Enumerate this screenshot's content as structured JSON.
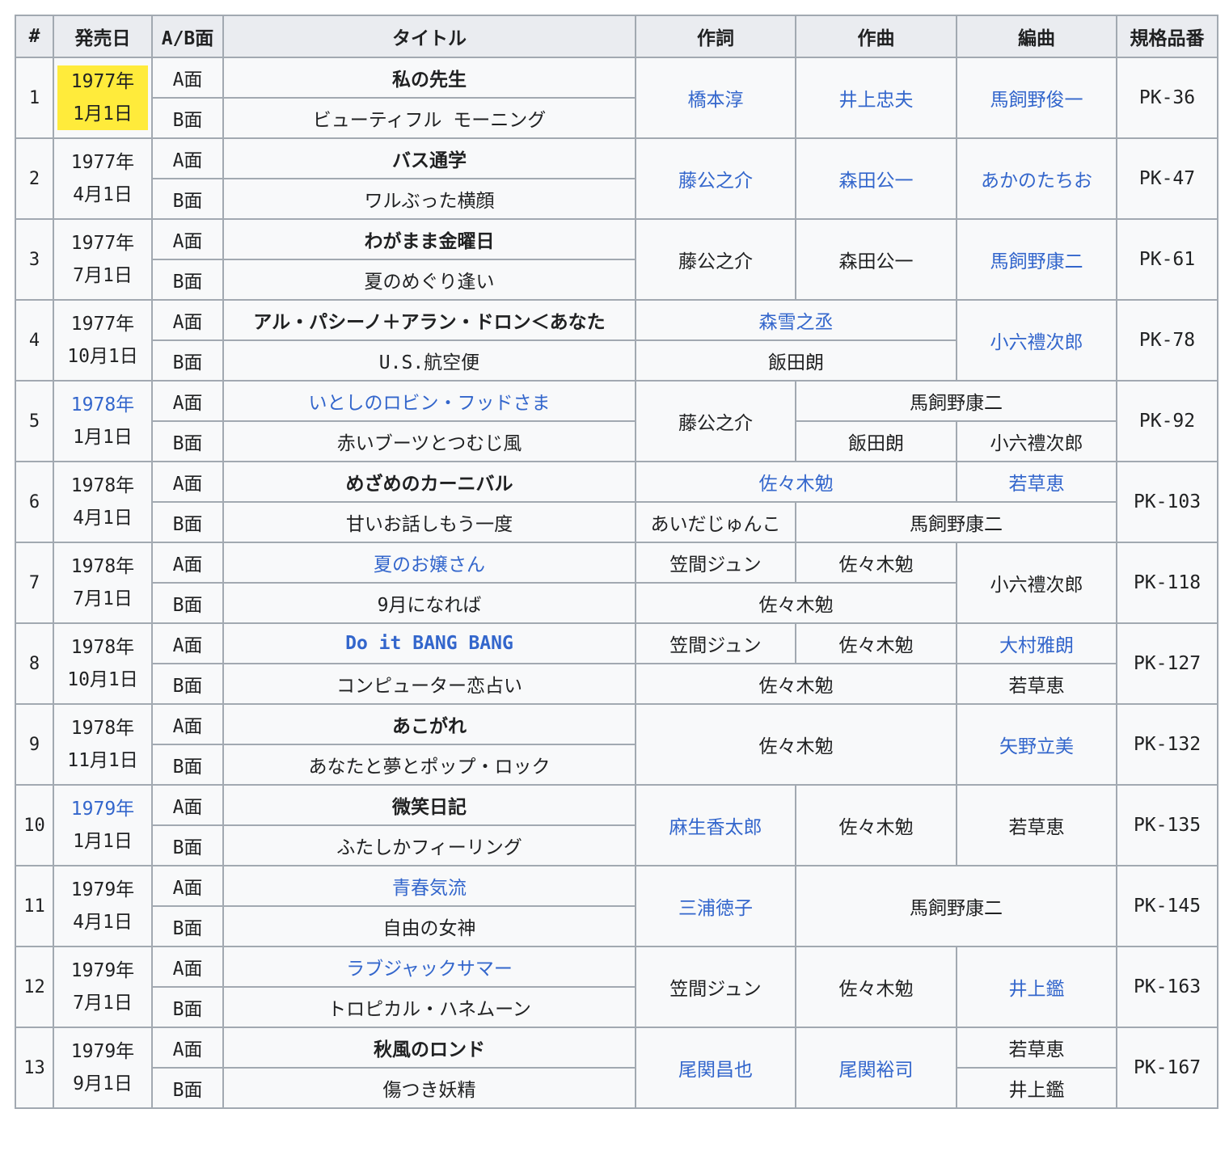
{
  "headers": [
    "#",
    "発売日",
    "A/B面",
    "タイトル",
    "作詞",
    "作曲",
    "編曲",
    "規格品番"
  ],
  "a_side": "A面",
  "b_side": "B面",
  "rows": [
    {
      "num": "1",
      "year": "1977年",
      "day": "1月1日",
      "a": "私の先生",
      "b": "ビューティフル モーニング",
      "lyric": "橋本淳",
      "composer": "井上忠夫",
      "arranger": "馬飼野俊一",
      "catalog": "PK-36"
    },
    {
      "num": "2",
      "year": "1977年",
      "day": "4月1日",
      "a": "バス通学",
      "b": "ワルぶった横顔",
      "lyric": "藤公之介",
      "composer": "森田公一",
      "arranger": "あかのたちお",
      "catalog": "PK-47"
    },
    {
      "num": "3",
      "year": "1977年",
      "day": "7月1日",
      "a": "わがまま金曜日",
      "b": "夏のめぐり逢い",
      "lyric": "藤公之介",
      "composer": "森田公一",
      "arranger": "馬飼野康二",
      "catalog": "PK-61"
    },
    {
      "num": "4",
      "year": "1977年",
      "day": "10月1日",
      "a": "アル・パシーノ＋アラン・ドロン＜あなた",
      "b": "U.S.航空便",
      "lyric_composer_a": "森雪之丞",
      "lyric_composer_b": "飯田朗",
      "arranger": "小六禮次郎",
      "catalog": "PK-78"
    },
    {
      "num": "5",
      "year": "1978年",
      "day": "1月1日",
      "a": "いとしのロビン・フッドさま",
      "b": "赤いブーツとつむじ風",
      "lyric": "藤公之介",
      "comp_arr_a": "馬飼野康二",
      "composer_b": "飯田朗",
      "arranger_b": "小六禮次郎",
      "catalog": "PK-92"
    },
    {
      "num": "6",
      "year": "1978年",
      "day": "4月1日",
      "a": "めざめのカーニバル",
      "b": "甘いお話しもう一度",
      "lyric_composer_a": "佐々木勉",
      "arranger_a": "若草恵",
      "lyric_b": "あいだじゅんこ",
      "comp_arr_b": "馬飼野康二",
      "catalog": "PK-103"
    },
    {
      "num": "7",
      "year": "1978年",
      "day": "7月1日",
      "a": "夏のお嬢さん",
      "b": "9月になれば",
      "lyric_a": "笠間ジュン",
      "composer_a": "佐々木勉",
      "lyric_composer_b": "佐々木勉",
      "arranger": "小六禮次郎",
      "catalog": "PK-118"
    },
    {
      "num": "8",
      "year": "1978年",
      "day": "10月1日",
      "a": "Do it BANG BANG",
      "b": "コンピューター恋占い",
      "lyric_a": "笠間ジュン",
      "composer_a": "佐々木勉",
      "arranger_a": "大村雅朗",
      "lyric_composer_b": "佐々木勉",
      "arranger_b": "若草恵",
      "catalog": "PK-127"
    },
    {
      "num": "9",
      "year": "1978年",
      "day": "11月1日",
      "a": "あこがれ",
      "b": "あなたと夢とポップ・ロック",
      "lyric_composer": "佐々木勉",
      "arranger": "矢野立美",
      "catalog": "PK-132"
    },
    {
      "num": "10",
      "year": "1979年",
      "day": "1月1日",
      "a": "微笑日記",
      "b": "ふたしかフィーリング",
      "lyric": "麻生香太郎",
      "composer": "佐々木勉",
      "arranger": "若草恵",
      "catalog": "PK-135"
    },
    {
      "num": "11",
      "year": "1979年",
      "day": "4月1日",
      "a": "青春気流",
      "b": "自由の女神",
      "lyric": "三浦徳子",
      "comp_arr": "馬飼野康二",
      "catalog": "PK-145"
    },
    {
      "num": "12",
      "year": "1979年",
      "day": "7月1日",
      "a": "ラブジャックサマー",
      "b": "トロピカル・ハネムーン",
      "lyric": "笠間ジュン",
      "composer": "佐々木勉",
      "arranger": "井上鑑",
      "catalog": "PK-163"
    },
    {
      "num": "13",
      "year": "1979年",
      "day": "9月1日",
      "a": "秋風のロンド",
      "b": "傷つき妖精",
      "lyric": "尾関昌也",
      "composer": "尾関裕司",
      "arranger_a": "若草恵",
      "arranger_b": "井上鑑",
      "catalog": "PK-167"
    }
  ],
  "colors": {
    "link": "#3366cc",
    "highlight": "#ffeb3b",
    "header_bg": "#eaecf0",
    "cell_bg": "#f8f9fa",
    "border": "#a2a9b1"
  }
}
